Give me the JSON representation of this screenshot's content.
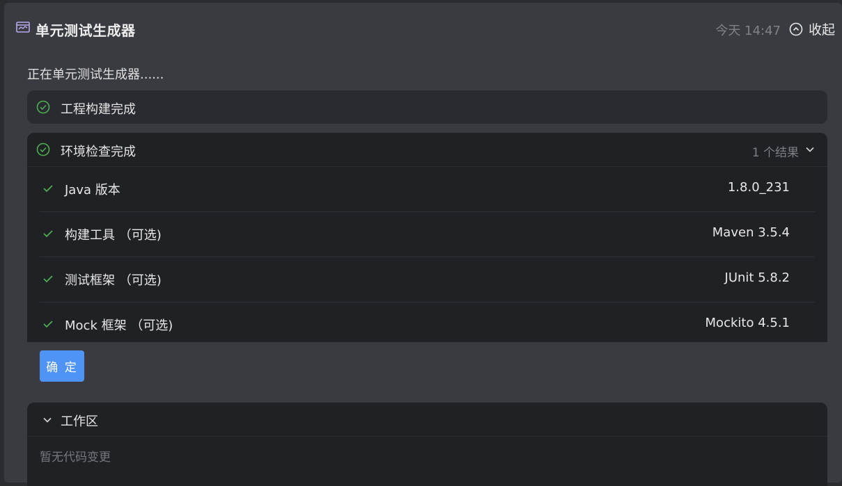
{
  "header": {
    "title": "单元测试生成器",
    "time": "今天 14:47",
    "collapse_label": "收起"
  },
  "status_line": "正在单元测试生成器......",
  "steps": [
    {
      "label": "工程构建完成",
      "status": "done"
    },
    {
      "label": "环境检查完成",
      "status": "done",
      "result_count": "1 个结果",
      "expanded": true
    }
  ],
  "env_checks": [
    {
      "label": "Java 版本",
      "value": "1.8.0_231"
    },
    {
      "label": "构建工具 （可选)",
      "value": "Maven 3.5.4"
    },
    {
      "label": "测试框架 （可选)",
      "value": "JUnit 5.8.2"
    },
    {
      "label": "Mock 框架 （可选)",
      "value": "Mockito 4.5.1"
    }
  ],
  "confirm_label": "确 定",
  "workspace": {
    "title": "工作区",
    "empty_text": "暂无代码变更"
  },
  "colors": {
    "accent": "#4f93f5",
    "success": "#4caf50",
    "panel_bg": "#3a3b40",
    "card_bg": "#202124"
  },
  "icons": {
    "title": "dashboard-icon",
    "collapse": "chevron-up-circle-icon",
    "step_done": "check-circle-icon",
    "row_done": "check-icon",
    "expand": "chevron-down-icon"
  }
}
